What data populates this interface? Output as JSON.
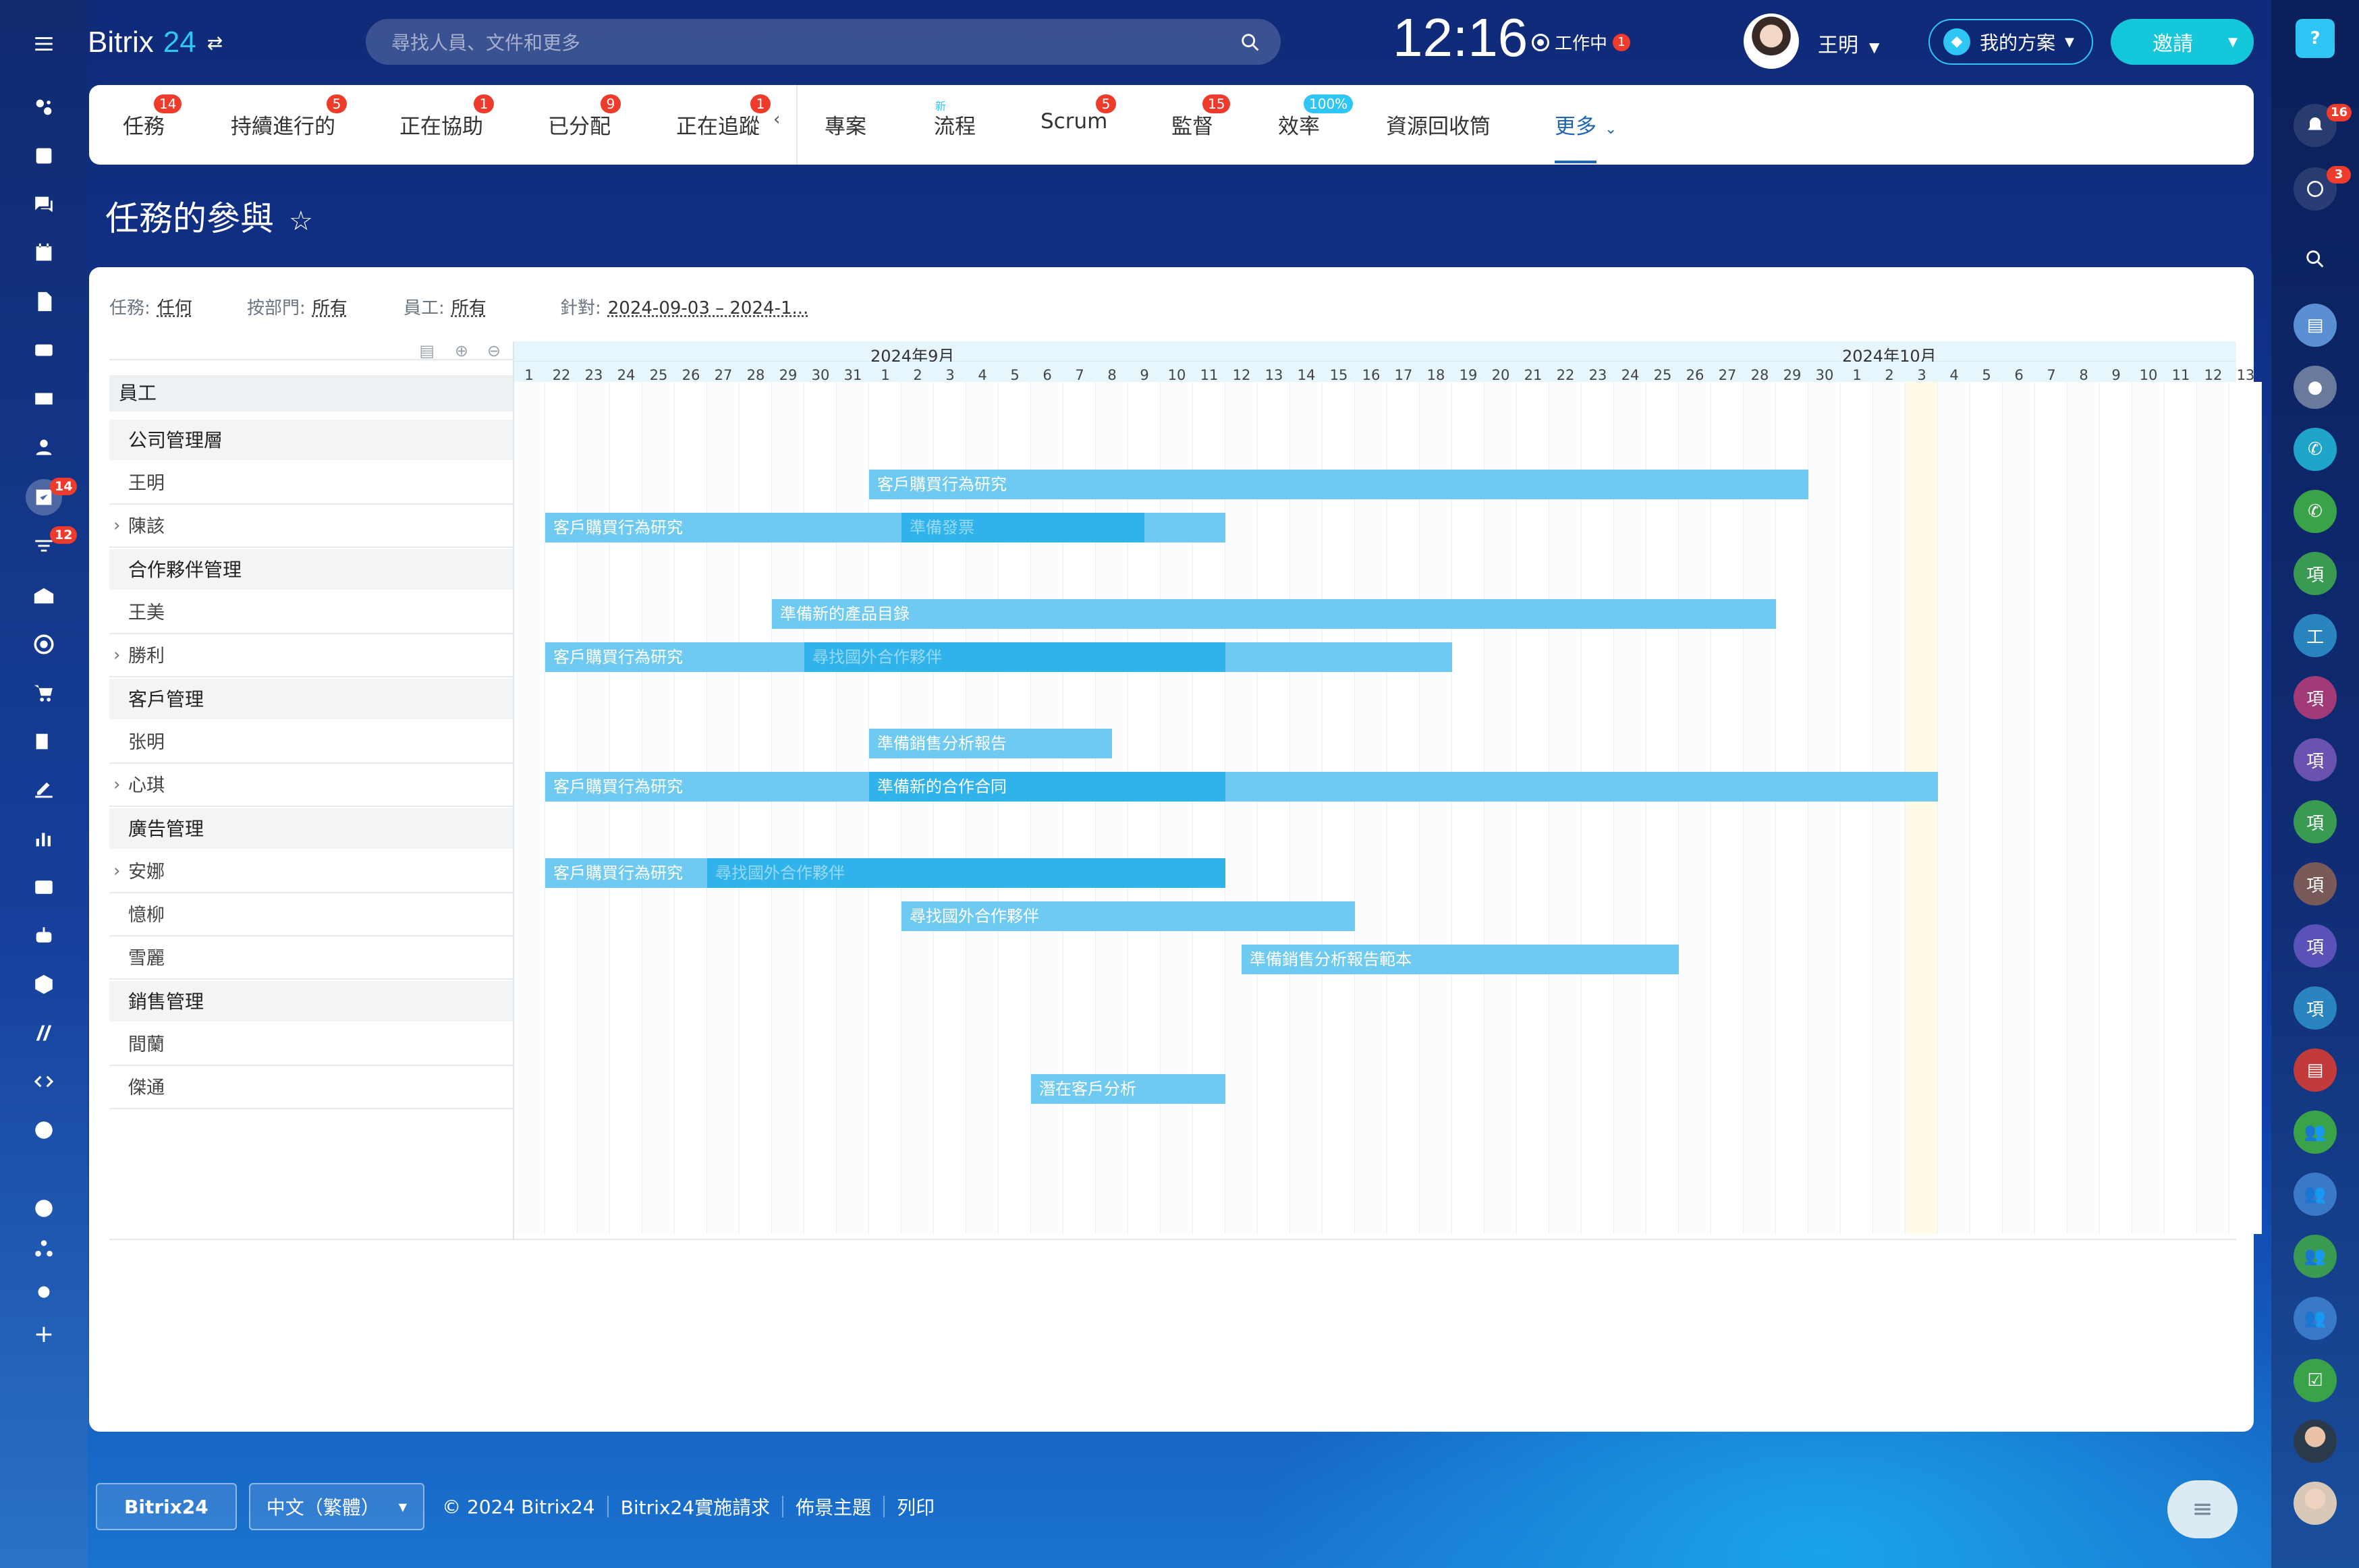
{
  "header": {
    "brand_main": "Bitrix",
    "brand_num": "24",
    "search_placeholder": "尋找人員、文件和更多",
    "clock": "12:16",
    "work_status": "工作中",
    "work_badge": "1",
    "user_name": "王明",
    "plan_label": "我的方案",
    "invite_label": "邀請"
  },
  "left_sidebar": {
    "tasks_badge": "14",
    "feed_badge": "12"
  },
  "right_sidebar": {
    "notifications_badge": "16",
    "chat_badge": "3",
    "avatar_letters": [
      "項",
      "工",
      "項",
      "項",
      "項",
      "項",
      "項",
      "項"
    ]
  },
  "tabs": [
    {
      "label": "任務",
      "badge": "14"
    },
    {
      "label": "持續進行的",
      "badge": "5"
    },
    {
      "label": "正在協助",
      "badge": "1"
    },
    {
      "label": "已分配",
      "badge": "9"
    },
    {
      "label": "正在追蹤",
      "badge": "1"
    },
    {
      "label": "專案",
      "badge": ""
    },
    {
      "label": "流程",
      "badge": "新"
    },
    {
      "label": "Scrum",
      "badge": "5"
    },
    {
      "label": "監督",
      "badge": "15"
    },
    {
      "label": "效率",
      "badge": "100%"
    },
    {
      "label": "資源回收筒",
      "badge": ""
    },
    {
      "label": "更多",
      "badge": ""
    }
  ],
  "page_title": "任務的參與",
  "filters": {
    "task_label": "任務:",
    "task_value": "任何",
    "dept_label": "按部門:",
    "dept_value": "所有",
    "emp_label": "員工:",
    "emp_value": "所有",
    "range_label": "針對:",
    "range_value": "2024-09-03 – 2024-1..."
  },
  "gantt": {
    "employees_header": "員工",
    "month_sep": "2024年9月",
    "month_oct": "2024年10月",
    "days": [
      "1",
      "22",
      "23",
      "24",
      "25",
      "26",
      "27",
      "28",
      "29",
      "30",
      "31",
      "1",
      "2",
      "3",
      "4",
      "5",
      "6",
      "7",
      "8",
      "9",
      "10",
      "11",
      "12",
      "13",
      "14",
      "15",
      "16",
      "17",
      "18",
      "19",
      "20",
      "21",
      "22",
      "23",
      "24",
      "25",
      "26",
      "27",
      "28",
      "29",
      "30",
      "1",
      "2",
      "3",
      "4",
      "5",
      "6",
      "7",
      "8",
      "9",
      "10",
      "11",
      "12",
      "13"
    ],
    "rows": [
      {
        "type": "group",
        "label": "公司管理層"
      },
      {
        "type": "emp",
        "label": "王明",
        "expand": false
      },
      {
        "type": "emp",
        "label": "陳該",
        "expand": true
      },
      {
        "type": "group",
        "label": "合作夥伴管理"
      },
      {
        "type": "emp",
        "label": "王美",
        "expand": false
      },
      {
        "type": "emp",
        "label": "勝利",
        "expand": true
      },
      {
        "type": "group",
        "label": "客戶管理"
      },
      {
        "type": "emp",
        "label": "张明",
        "expand": false
      },
      {
        "type": "emp",
        "label": "心琪",
        "expand": true
      },
      {
        "type": "group",
        "label": "廣告管理"
      },
      {
        "type": "emp",
        "label": "安娜",
        "expand": true
      },
      {
        "type": "emp",
        "label": "憶柳",
        "expand": false
      },
      {
        "type": "emp",
        "label": "雪麗",
        "expand": false
      },
      {
        "type": "group",
        "label": "銷售管理"
      },
      {
        "type": "emp",
        "label": "間蘭",
        "expand": false
      },
      {
        "type": "emp",
        "label": "傑通",
        "expand": false
      }
    ],
    "bars": [
      {
        "row": 1,
        "start": 11,
        "end": 40,
        "label": "客戶購買行為研究"
      },
      {
        "row": 2,
        "start": 1,
        "end": 22,
        "label": "客戶購買行為研究"
      },
      {
        "row": 2,
        "start": 12,
        "end": 19.5,
        "label": "準備發票",
        "overlay": true
      },
      {
        "row": 4,
        "start": 8,
        "end": 39,
        "label": "準備新的產品目錄"
      },
      {
        "row": 5,
        "start": 1,
        "end": 29,
        "label": "客戶購買行為研究"
      },
      {
        "row": 5,
        "start": 9,
        "end": 22,
        "label": "尋找國外合作夥伴",
        "overlay": true
      },
      {
        "row": 7,
        "start": 11,
        "end": 18.5,
        "label": "準備銷售分析報告"
      },
      {
        "row": 8,
        "start": 1,
        "end": 44,
        "label": "客戶購買行為研究"
      },
      {
        "row": 8,
        "start": 11,
        "end": 22,
        "label": "準備新的合作合同",
        "overlay": true,
        "bright": true
      },
      {
        "row": 10,
        "start": 1,
        "end": 22,
        "label": "客戶購買行為研究"
      },
      {
        "row": 10,
        "start": 6,
        "end": 22,
        "label": "尋找國外合作夥伴",
        "overlay": true
      },
      {
        "row": 11,
        "start": 12,
        "end": 26,
        "label": "尋找國外合作夥伴"
      },
      {
        "row": 12,
        "start": 22.5,
        "end": 36,
        "label": "準備銷售分析報告範本"
      },
      {
        "row": 15,
        "start": 16,
        "end": 22,
        "label": "潛在客戶分析"
      }
    ]
  },
  "footer": {
    "brand": "Bitrix24",
    "language": "中文（繁體）",
    "copyright": "© 2024 Bitrix24",
    "link_impl": "Bitrix24實施請求",
    "link_theme": "佈景主題",
    "link_print": "列印"
  },
  "colors": {
    "accent": "#2fc6f6",
    "badge": "#ef3b2c",
    "bar": "#6fcaf1",
    "bar_overlay": "#2fb3ea",
    "today": "#fffbe6"
  }
}
